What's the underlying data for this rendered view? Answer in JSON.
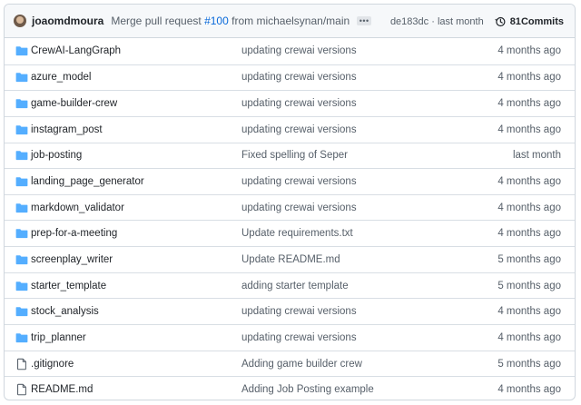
{
  "header": {
    "author": "joaomdmoura",
    "message_prefix": "Merge pull request ",
    "pr_link": "#100",
    "message_suffix": " from michaelsynan/main",
    "ellipsis": "•••",
    "sha": "de183dc",
    "sha_sep": " · ",
    "when": "last month",
    "commits_count": "81",
    "commits_label": " Commits"
  },
  "colors": {
    "folder": "#54aeff",
    "link": "#0969da",
    "muted": "#57606a"
  },
  "files": [
    {
      "name": "CrewAI-LangGraph",
      "type": "folder",
      "icon": "folder-icon",
      "message": "updating crewai versions",
      "age": "4 months ago"
    },
    {
      "name": "azure_model",
      "type": "folder",
      "icon": "folder-icon",
      "message": "updating crewai versions",
      "age": "4 months ago"
    },
    {
      "name": "game-builder-crew",
      "type": "folder",
      "icon": "folder-icon",
      "message": "updating crewai versions",
      "age": "4 months ago"
    },
    {
      "name": "instagram_post",
      "type": "folder",
      "icon": "folder-icon",
      "message": "updating crewai versions",
      "age": "4 months ago"
    },
    {
      "name": "job-posting",
      "type": "folder",
      "icon": "folder-icon",
      "message": "Fixed spelling of Seper",
      "age": "last month"
    },
    {
      "name": "landing_page_generator",
      "type": "folder",
      "icon": "folder-icon",
      "message": "updating crewai versions",
      "age": "4 months ago"
    },
    {
      "name": "markdown_validator",
      "type": "folder",
      "icon": "folder-icon",
      "message": "updating crewai versions",
      "age": "4 months ago"
    },
    {
      "name": "prep-for-a-meeting",
      "type": "folder",
      "icon": "folder-icon",
      "message": "Update requirements.txt",
      "age": "4 months ago"
    },
    {
      "name": "screenplay_writer",
      "type": "folder",
      "icon": "folder-icon",
      "message": "Update README.md",
      "age": "5 months ago"
    },
    {
      "name": "starter_template",
      "type": "folder",
      "icon": "folder-icon",
      "message": "adding starter template",
      "age": "5 months ago"
    },
    {
      "name": "stock_analysis",
      "type": "folder",
      "icon": "folder-icon",
      "message": "updating crewai versions",
      "age": "4 months ago"
    },
    {
      "name": "trip_planner",
      "type": "folder",
      "icon": "folder-icon",
      "message": "updating crewai versions",
      "age": "4 months ago"
    },
    {
      "name": ".gitignore",
      "type": "file",
      "icon": "file-icon",
      "message": "Adding game builder crew",
      "age": "5 months ago"
    },
    {
      "name": "README.md",
      "type": "file",
      "icon": "file-icon",
      "message": "Adding Job Posting example",
      "age": "4 months ago"
    }
  ]
}
